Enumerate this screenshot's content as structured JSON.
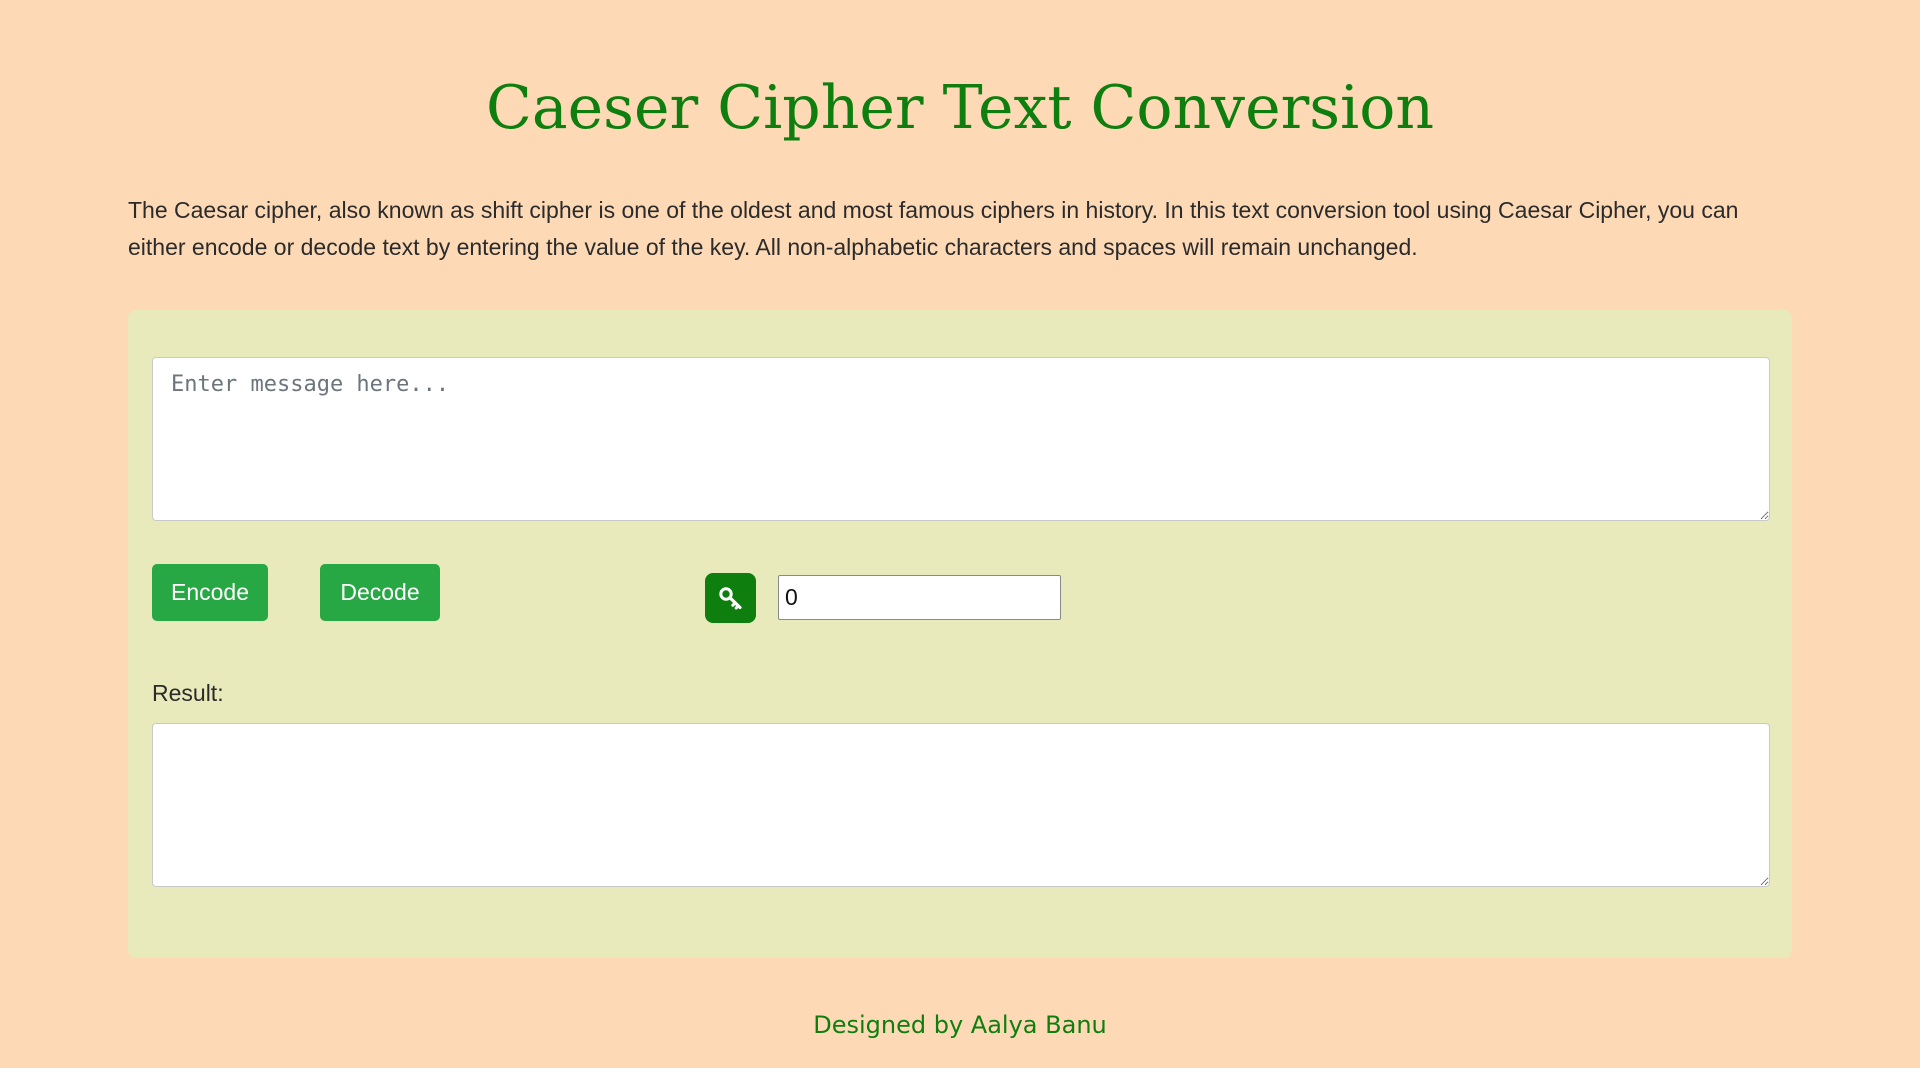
{
  "page": {
    "title": "Caeser Cipher Text Conversion",
    "description": "The Caesar cipher, also known as shift cipher is one of the oldest and most famous ciphers in history. In this text conversion tool using Caesar Cipher, you can either encode or decode text by entering the value of the key. All non-alphabetic characters and spaces will remain unchanged."
  },
  "form": {
    "message_placeholder": "Enter message here...",
    "message_value": "",
    "encode_label": "Encode",
    "decode_label": "Decode",
    "key_icon": "key-icon",
    "key_value": "0",
    "result_label": "Result:",
    "result_value": ""
  },
  "footer": {
    "credit": "Designed by Aalya Banu"
  },
  "colors": {
    "background": "#fdd9b6",
    "panel": "#e8eabb",
    "title_green": "#0e7f0e",
    "button_green": "#28a745"
  }
}
